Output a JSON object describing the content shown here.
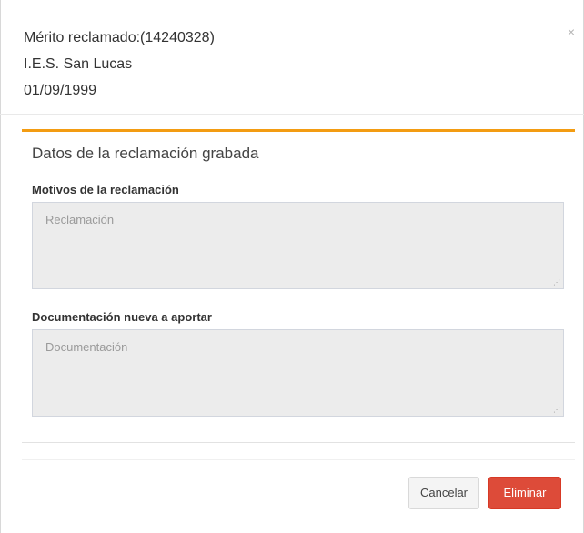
{
  "header": {
    "line1": "Mérito reclamado:(14240328)",
    "line2": "I.E.S. San Lucas",
    "line3": "01/09/1999",
    "close_glyph": "×"
  },
  "box": {
    "title": "Datos de la reclamación grabada",
    "accent_color": "#f39c12",
    "fields": [
      {
        "label": "Motivos de la reclamación",
        "placeholder": "Reclamación",
        "value": ""
      },
      {
        "label": "Documentación nueva a aportar",
        "placeholder": "Documentación",
        "value": ""
      }
    ]
  },
  "footer": {
    "cancel_label": "Cancelar",
    "delete_label": "Eliminar",
    "delete_color": "#dd4b39"
  },
  "icons": {
    "close": "close-icon",
    "resize": "resize-grip-icon"
  }
}
